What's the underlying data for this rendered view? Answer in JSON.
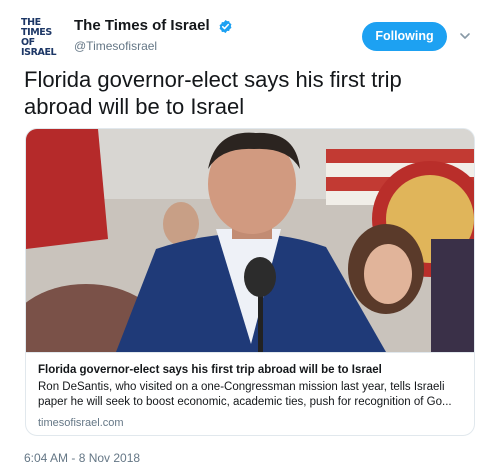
{
  "account": {
    "avatar_line1": "THE TIMES",
    "avatar_line2": "OF ISRAEL",
    "display_name": "The Times of Israel",
    "handle": "@Timesofisrael",
    "verified_icon": "verified-badge-icon"
  },
  "follow_button": {
    "label": "Following"
  },
  "menu": {
    "icon": "chevron-down-icon"
  },
  "tweet": {
    "text_line1": "Florida governor-elect says his first trip",
    "text_line2": "abroad will be to Israel"
  },
  "card": {
    "image_alt": "Ron DeSantis speaking at a microphone",
    "title": "Florida governor-elect says his first trip abroad will be to Israel",
    "desc_line1": "Ron DeSantis, who visited on a one-Congressman mission last year, tells Israeli",
    "desc_line2": "paper he will seek to boost economic, academic ties, push for recognition of Go...",
    "domain": "timesofisrael.com"
  },
  "timestamp": "6:04 AM - 8 Nov 2018",
  "colors": {
    "accent": "#1da1f2",
    "text": "#14171a",
    "secondary": "#657786",
    "border": "#e1e8ed",
    "logo": "#1d3766"
  }
}
